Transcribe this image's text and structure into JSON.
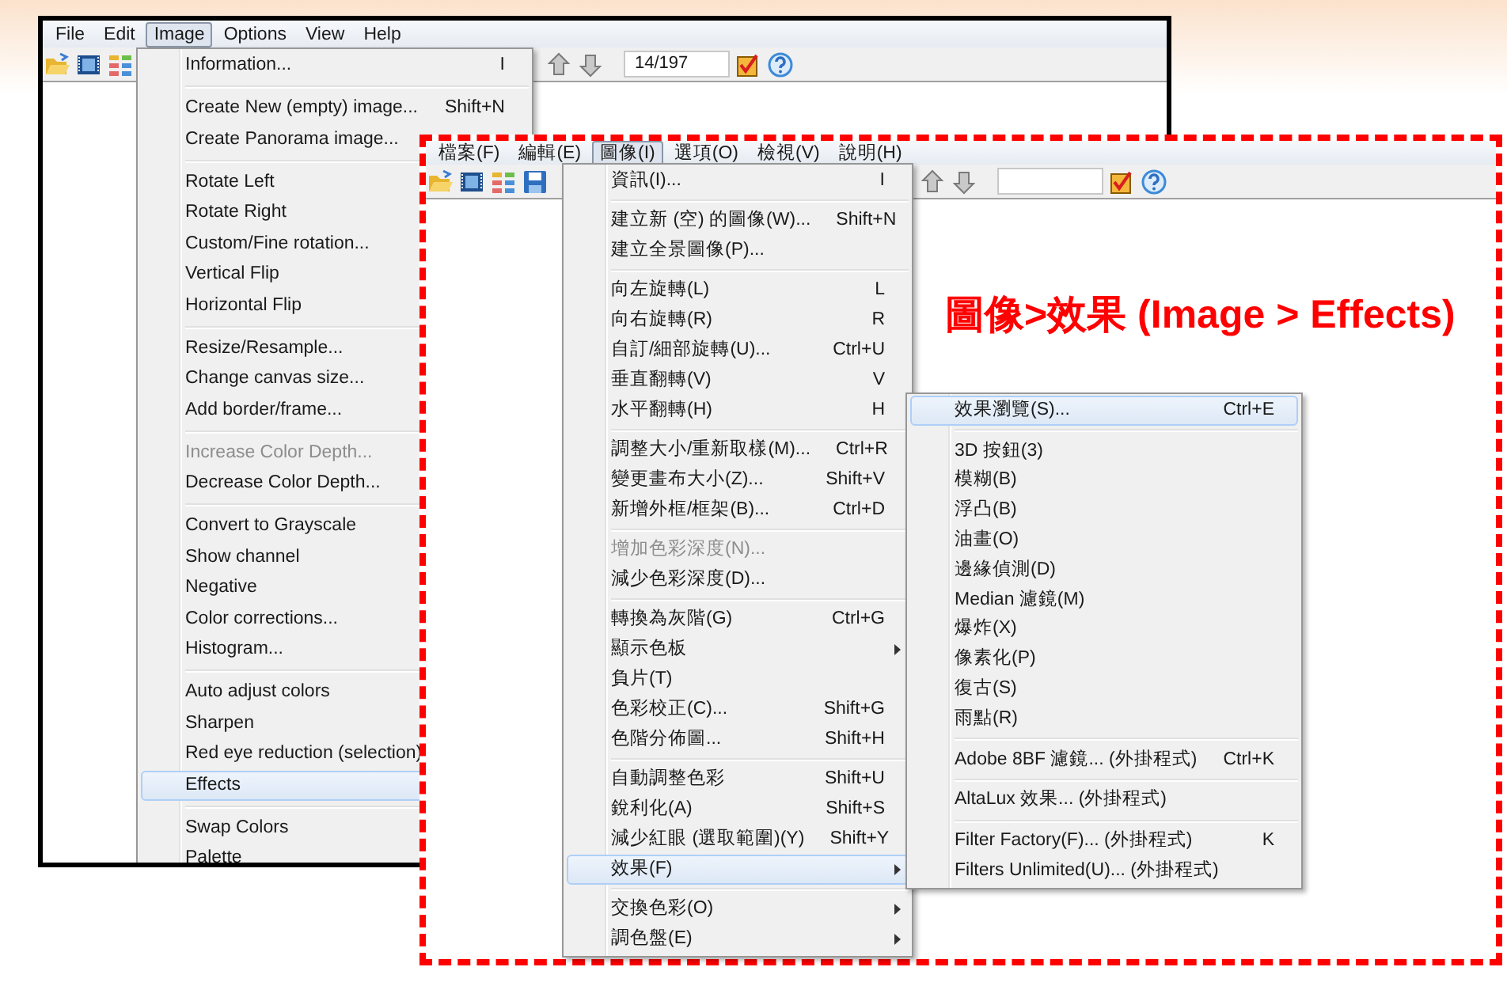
{
  "annotation": "圖像>效果 (Image > Effects)",
  "windows": [
    {
      "kind": "english",
      "menubar": [
        {
          "label": "File",
          "selected": false
        },
        {
          "label": "Edit",
          "selected": false
        },
        {
          "label": "Image",
          "selected": true
        },
        {
          "label": "Options",
          "selected": false
        },
        {
          "label": "View",
          "selected": false
        },
        {
          "label": "Help",
          "selected": false
        }
      ],
      "toolbar": {
        "counter": "14/197"
      },
      "menu": {
        "items": [
          {
            "kind": "item",
            "label": "Information...",
            "shortcut": "I",
            "selected": false,
            "disabled": false
          },
          {
            "kind": "separator"
          },
          {
            "kind": "item",
            "label": "Create New (empty) image...",
            "shortcut": "Shift+N",
            "selected": false,
            "disabled": false
          },
          {
            "kind": "item",
            "label": "Create Panorama image...",
            "selected": false,
            "disabled": false
          },
          {
            "kind": "separator"
          },
          {
            "kind": "item",
            "label": "Rotate Left",
            "selected": false,
            "disabled": false
          },
          {
            "kind": "item",
            "label": "Rotate Right",
            "selected": false,
            "disabled": false
          },
          {
            "kind": "item",
            "label": "Custom/Fine rotation...",
            "selected": false,
            "disabled": false
          },
          {
            "kind": "item",
            "label": "Vertical Flip",
            "selected": false,
            "disabled": false
          },
          {
            "kind": "item",
            "label": "Horizontal Flip",
            "selected": false,
            "disabled": false
          },
          {
            "kind": "separator"
          },
          {
            "kind": "item",
            "label": "Resize/Resample...",
            "selected": false,
            "disabled": false
          },
          {
            "kind": "item",
            "label": "Change canvas size...",
            "selected": false,
            "disabled": false
          },
          {
            "kind": "item",
            "label": "Add border/frame...",
            "selected": false,
            "disabled": false
          },
          {
            "kind": "separator"
          },
          {
            "kind": "item",
            "label": "Increase Color Depth...",
            "selected": false,
            "disabled": true
          },
          {
            "kind": "item",
            "label": "Decrease Color Depth...",
            "selected": false,
            "disabled": false
          },
          {
            "kind": "separator"
          },
          {
            "kind": "item",
            "label": "Convert to Grayscale",
            "selected": false,
            "disabled": false
          },
          {
            "kind": "item",
            "label": "Show channel",
            "selected": false,
            "disabled": false
          },
          {
            "kind": "item",
            "label": "Negative",
            "selected": false,
            "disabled": false
          },
          {
            "kind": "item",
            "label": "Color corrections...",
            "selected": false,
            "disabled": false
          },
          {
            "kind": "item",
            "label": "Histogram...",
            "selected": false,
            "disabled": false
          },
          {
            "kind": "separator"
          },
          {
            "kind": "item",
            "label": "Auto adjust colors",
            "selected": false,
            "disabled": false
          },
          {
            "kind": "item",
            "label": "Sharpen",
            "selected": false,
            "disabled": false
          },
          {
            "kind": "item",
            "label": "Red eye reduction (selection)",
            "selected": false,
            "disabled": false
          },
          {
            "kind": "item",
            "label": "Effects",
            "selected": true,
            "disabled": false
          },
          {
            "kind": "separator"
          },
          {
            "kind": "item",
            "label": "Swap Colors",
            "selected": false,
            "disabled": false
          },
          {
            "kind": "item",
            "label": "Palette",
            "selected": false,
            "disabled": false
          }
        ]
      }
    },
    {
      "kind": "chinese",
      "menubar": [
        {
          "label": "檔案(F)",
          "selected": false
        },
        {
          "label": "編輯(E)",
          "selected": false
        },
        {
          "label": "圖像(I)",
          "selected": true
        },
        {
          "label": "選項(O)",
          "selected": false
        },
        {
          "label": "檢視(V)",
          "selected": false
        },
        {
          "label": "說明(H)",
          "selected": false
        }
      ],
      "menu": {
        "items": [
          {
            "kind": "item",
            "label": "資訊(I)...",
            "shortcut": "I",
            "selected": false,
            "disabled": false,
            "submenu": false
          },
          {
            "kind": "separator"
          },
          {
            "kind": "item",
            "label": "建立新 (空) 的圖像(W)...",
            "shortcut": "Shift+N",
            "selected": false,
            "disabled": false,
            "submenu": false
          },
          {
            "kind": "item",
            "label": "建立全景圖像(P)...",
            "selected": false,
            "disabled": false,
            "submenu": false
          },
          {
            "kind": "separator"
          },
          {
            "kind": "item",
            "label": "向左旋轉(L)",
            "shortcut": "L",
            "selected": false,
            "disabled": false,
            "submenu": false
          },
          {
            "kind": "item",
            "label": "向右旋轉(R)",
            "shortcut": "R",
            "selected": false,
            "disabled": false,
            "submenu": false
          },
          {
            "kind": "item",
            "label": "自訂/細部旋轉(U)...",
            "shortcut": "Ctrl+U",
            "selected": false,
            "disabled": false,
            "submenu": false
          },
          {
            "kind": "item",
            "label": "垂直翻轉(V)",
            "shortcut": "V",
            "selected": false,
            "disabled": false,
            "submenu": false
          },
          {
            "kind": "item",
            "label": "水平翻轉(H)",
            "shortcut": "H",
            "selected": false,
            "disabled": false,
            "submenu": false
          },
          {
            "kind": "separator"
          },
          {
            "kind": "item",
            "label": "調整大小/重新取樣(M)...",
            "shortcut": "Ctrl+R",
            "selected": false,
            "disabled": false,
            "submenu": false
          },
          {
            "kind": "item",
            "label": "變更畫布大小(Z)...",
            "shortcut": "Shift+V",
            "selected": false,
            "disabled": false,
            "submenu": false
          },
          {
            "kind": "item",
            "label": "新增外框/框架(B)...",
            "shortcut": "Ctrl+D",
            "selected": false,
            "disabled": false,
            "submenu": false
          },
          {
            "kind": "separator"
          },
          {
            "kind": "item",
            "label": "增加色彩深度(N)...",
            "selected": false,
            "disabled": true,
            "submenu": false
          },
          {
            "kind": "item",
            "label": "減少色彩深度(D)...",
            "selected": false,
            "disabled": false,
            "submenu": false
          },
          {
            "kind": "separator"
          },
          {
            "kind": "item",
            "label": "轉換為灰階(G)",
            "shortcut": "Ctrl+G",
            "selected": false,
            "disabled": false,
            "submenu": false
          },
          {
            "kind": "item",
            "label": "顯示色板",
            "selected": false,
            "disabled": false,
            "submenu": true
          },
          {
            "kind": "item",
            "label": "負片(T)",
            "selected": false,
            "disabled": false,
            "submenu": false
          },
          {
            "kind": "item",
            "label": "色彩校正(C)...",
            "shortcut": "Shift+G",
            "selected": false,
            "disabled": false,
            "submenu": false
          },
          {
            "kind": "item",
            "label": "色階分佈圖...",
            "shortcut": "Shift+H",
            "selected": false,
            "disabled": false,
            "submenu": false
          },
          {
            "kind": "separator"
          },
          {
            "kind": "item",
            "label": "自動調整色彩",
            "shortcut": "Shift+U",
            "selected": false,
            "disabled": false,
            "submenu": false
          },
          {
            "kind": "item",
            "label": "銳利化(A)",
            "shortcut": "Shift+S",
            "selected": false,
            "disabled": false,
            "submenu": false
          },
          {
            "kind": "item",
            "label": "減少紅眼 (選取範圍)(Y)",
            "shortcut": "Shift+Y",
            "selected": false,
            "disabled": false,
            "submenu": false
          },
          {
            "kind": "item",
            "label": "效果(F)",
            "selected": true,
            "disabled": false,
            "submenu": true
          },
          {
            "kind": "separator"
          },
          {
            "kind": "item",
            "label": "交換色彩(O)",
            "selected": false,
            "disabled": false,
            "submenu": true
          },
          {
            "kind": "item",
            "label": "調色盤(E)",
            "selected": false,
            "disabled": false,
            "submenu": true
          }
        ]
      },
      "submenu": {
        "items": [
          {
            "kind": "item",
            "label": "效果瀏覽(S)...",
            "shortcut": "Ctrl+E",
            "selected": true
          },
          {
            "kind": "separator"
          },
          {
            "kind": "item",
            "label": "3D 按鈕(3)",
            "selected": false
          },
          {
            "kind": "item",
            "label": "模糊(B)",
            "selected": false
          },
          {
            "kind": "item",
            "label": "浮凸(B)",
            "selected": false
          },
          {
            "kind": "item",
            "label": "油畫(O)",
            "selected": false
          },
          {
            "kind": "item",
            "label": "邊緣偵測(D)",
            "selected": false
          },
          {
            "kind": "item",
            "label": "Median 濾鏡(M)",
            "selected": false
          },
          {
            "kind": "item",
            "label": "爆炸(X)",
            "selected": false
          },
          {
            "kind": "item",
            "label": "像素化(P)",
            "selected": false
          },
          {
            "kind": "item",
            "label": "復古(S)",
            "selected": false
          },
          {
            "kind": "item",
            "label": "雨點(R)",
            "selected": false
          },
          {
            "kind": "separator"
          },
          {
            "kind": "item",
            "label": "Adobe 8BF 濾鏡... (外掛程式)",
            "shortcut": "Ctrl+K",
            "selected": false
          },
          {
            "kind": "separator"
          },
          {
            "kind": "item",
            "label": "AltaLux 效果... (外掛程式)",
            "selected": false
          },
          {
            "kind": "separator"
          },
          {
            "kind": "item",
            "label": "Filter Factory(F)... (外掛程式)",
            "shortcut": "K",
            "selected": false
          },
          {
            "kind": "item",
            "label": "Filters Unlimited(U)... (外掛程式)",
            "selected": false
          }
        ]
      }
    }
  ]
}
